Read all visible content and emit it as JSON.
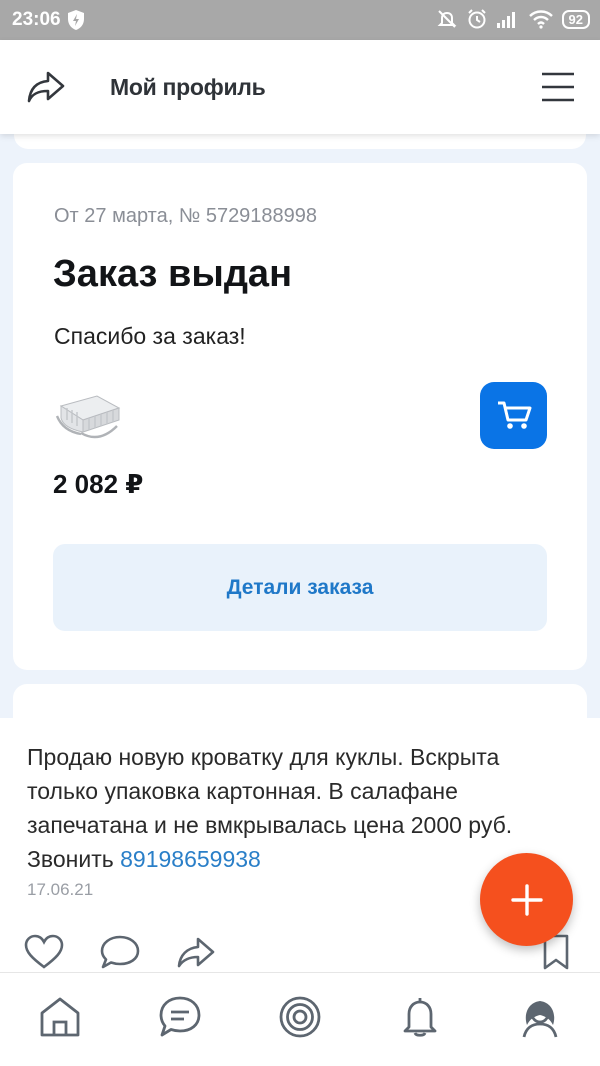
{
  "status_bar": {
    "time": "23:06",
    "battery": "92",
    "icons": [
      "shield-icon",
      "mute-icon",
      "alarm-icon",
      "signal-icon",
      "wifi-icon",
      "battery-icon"
    ]
  },
  "header": {
    "title": "Мой профиль",
    "icons": [
      "share-icon",
      "menu-icon"
    ]
  },
  "order": {
    "meta": "От 27 марта, № 5729188998",
    "status": "Заказ выдан",
    "thanks": "Спасибо за заказ!",
    "price": "2 082 ₽",
    "details_button": "Детали заказа",
    "product_icon": "doll-crib-thumbnail",
    "cart_icon": "cart-icon",
    "accent_color": "#0a74e6"
  },
  "post": {
    "text": "Продаю новую кроватку для куклы. Вскрыта только упаковка картонная. В салафане запечатана и не вмкрывалась цена 2000 руб. Звонить ",
    "phone": "89198659938",
    "date": "17.06.21",
    "actions": [
      "like-icon",
      "comment-icon",
      "repost-icon",
      "bookmark-icon"
    ]
  },
  "fab": {
    "icon": "plus-icon",
    "color": "#f5501e"
  },
  "bottom_nav": {
    "items": [
      "home-icon",
      "messages-icon",
      "target-icon",
      "notifications-icon",
      "profile-icon"
    ]
  }
}
